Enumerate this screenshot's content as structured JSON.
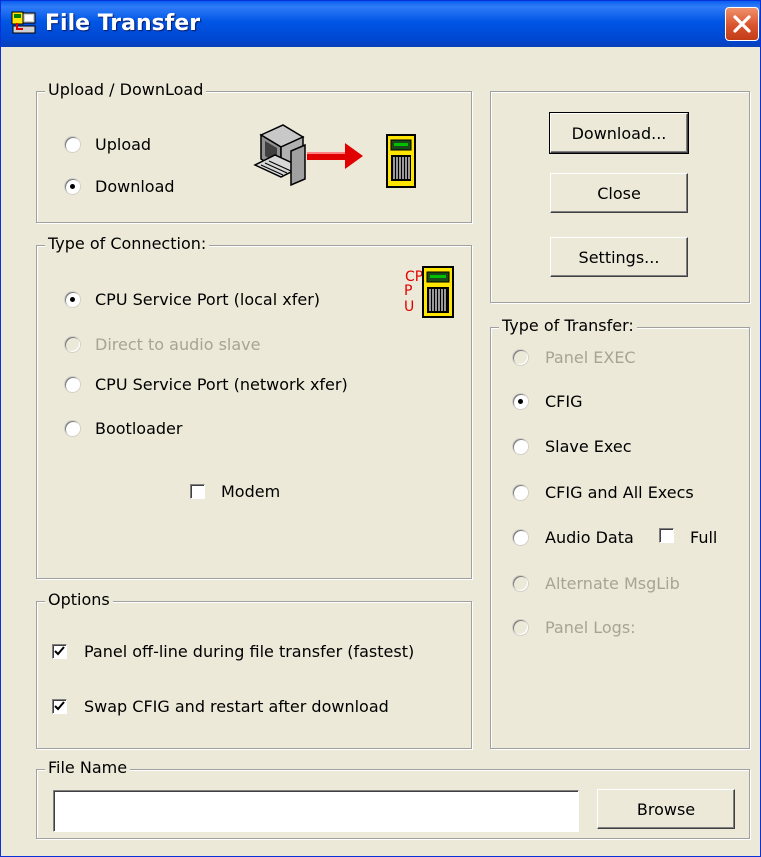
{
  "window": {
    "title": "File Transfer",
    "accent": "#0055e5"
  },
  "upload_download": {
    "legend": "Upload / DownLoad",
    "options": [
      {
        "label": "Upload",
        "selected": false
      },
      {
        "label": "Download",
        "selected": true
      }
    ],
    "icon": "pc-to-panel-transfer-icon"
  },
  "connection": {
    "legend": "Type of Connection:",
    "icon_text": "CPU",
    "options": [
      {
        "label": "CPU Service Port (local xfer)",
        "selected": true,
        "enabled": true
      },
      {
        "label": "Direct to audio slave",
        "selected": false,
        "enabled": false
      },
      {
        "label": "CPU Service Port (network xfer)",
        "selected": false,
        "enabled": true
      },
      {
        "label": "Bootloader",
        "selected": false,
        "enabled": true
      }
    ],
    "modem": {
      "label": "Modem",
      "checked": false
    }
  },
  "options": {
    "legend": "Options",
    "items": [
      {
        "label": "Panel off-line during file transfer (fastest)",
        "checked": true
      },
      {
        "label": "Swap CFIG and restart after download",
        "checked": true
      }
    ]
  },
  "buttons": {
    "download": "Download...",
    "close": "Close",
    "settings": "Settings...",
    "browse": "Browse"
  },
  "transfer": {
    "legend": "Type of Transfer:",
    "options": [
      {
        "label": "Panel EXEC",
        "selected": false,
        "enabled": false
      },
      {
        "label": "CFIG",
        "selected": true,
        "enabled": true
      },
      {
        "label": "Slave Exec",
        "selected": false,
        "enabled": true
      },
      {
        "label": "CFIG and All Execs",
        "selected": false,
        "enabled": true
      },
      {
        "label": "Audio Data",
        "selected": false,
        "enabled": true
      },
      {
        "label": "Alternate MsgLib",
        "selected": false,
        "enabled": false
      },
      {
        "label": "Panel Logs:",
        "selected": false,
        "enabled": false
      }
    ],
    "full": {
      "label": "Full",
      "checked": false
    }
  },
  "file": {
    "legend": "File Name",
    "value": ""
  }
}
